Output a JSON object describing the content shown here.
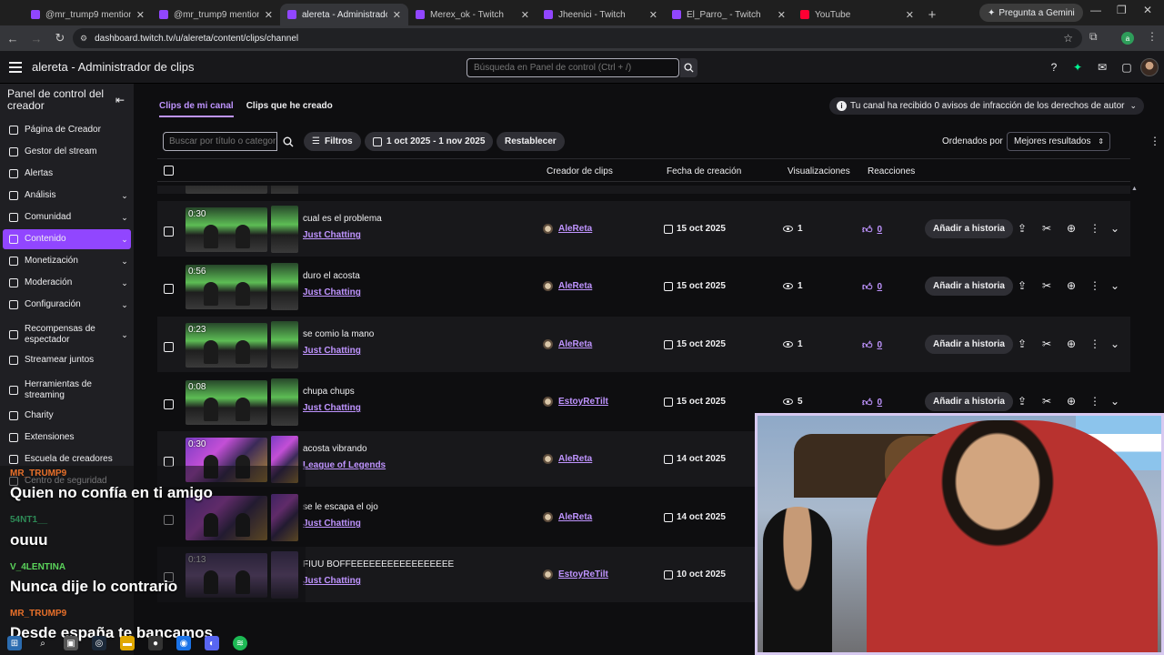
{
  "browser": {
    "tabs": [
      {
        "title": "@mr_trump9 mentioned y",
        "active": false
      },
      {
        "title": "@mr_trump9 mentioned y",
        "active": false
      },
      {
        "title": "alereta - Administrador de",
        "active": true
      },
      {
        "title": "Merex_ok - Twitch",
        "active": false
      },
      {
        "title": "Jheenici - Twitch",
        "active": false
      },
      {
        "title": "El_Parro_ - Twitch",
        "active": false
      },
      {
        "title": "YouTube",
        "active": false
      }
    ],
    "gemini_label": "Pregunta a Gemini",
    "url": "dashboard.twitch.tv/u/alereta/content/clips/channel",
    "profile_initial": "a"
  },
  "topnav": {
    "title": "alereta - Administrador de clips",
    "search_placeholder": "Búsqueda en Panel de control (Ctrl + /)"
  },
  "sidebar": {
    "heading": "Panel de control del creador",
    "items": [
      {
        "label": "Página de Creador",
        "chevron": false,
        "active": false
      },
      {
        "label": "Gestor del stream",
        "chevron": false,
        "active": false
      },
      {
        "label": "Alertas",
        "chevron": false,
        "active": false
      },
      {
        "label": "Análisis",
        "chevron": true,
        "active": false
      },
      {
        "label": "Comunidad",
        "chevron": true,
        "active": false
      },
      {
        "label": "Contenido",
        "chevron": true,
        "active": true
      },
      {
        "label": "Monetización",
        "chevron": true,
        "active": false
      },
      {
        "label": "Moderación",
        "chevron": true,
        "active": false
      },
      {
        "label": "Configuración",
        "chevron": true,
        "active": false
      },
      {
        "label": "Recompensas de espectador",
        "chevron": true,
        "active": false
      },
      {
        "label": "Streamear juntos",
        "chevron": false,
        "active": false
      },
      {
        "label": "Herramientas de streaming",
        "chevron": false,
        "active": false
      },
      {
        "label": "Charity",
        "chevron": false,
        "active": false
      },
      {
        "label": "Extensiones",
        "chevron": false,
        "active": false
      },
      {
        "label": "Escuela de creadores",
        "chevron": false,
        "active": false
      },
      {
        "label": "Centro de seguridad",
        "chevron": false,
        "active": false
      }
    ]
  },
  "content": {
    "tabs": [
      {
        "label": "Clips de mi canal",
        "active": true
      },
      {
        "label": "Clips que he creado",
        "active": false
      }
    ],
    "notice": "Tu canal ha recibido 0 avisos de infracción de los derechos de autor",
    "filters": {
      "search_placeholder": "Buscar por título o categoría",
      "filters_label": "Filtros",
      "date_range": "1 oct 2025 - 1 nov 2025",
      "reset_label": "Restablecer",
      "sort_label": "Ordenados por",
      "sort_value": "Mejores resultados"
    },
    "columns": {
      "creator": "Creador de clips",
      "date": "Fecha de creación",
      "views": "Visualizaciones",
      "reactions": "Reacciones"
    },
    "story_label": "Añadir a historia",
    "clips": [
      {
        "duration": "0:30",
        "title": "cual es el problema",
        "category": "Just Chatting",
        "creator": "AleReta",
        "date": "15 oct 2025",
        "views": "1",
        "reactions": "0",
        "theme": "green"
      },
      {
        "duration": "0:56",
        "title": "duro el acosta",
        "category": "Just Chatting",
        "creator": "AleReta",
        "date": "15 oct 2025",
        "views": "1",
        "reactions": "0",
        "theme": "green"
      },
      {
        "duration": "0:23",
        "title": "se comio la mano",
        "category": "Just Chatting",
        "creator": "AleReta",
        "date": "15 oct 2025",
        "views": "1",
        "reactions": "0",
        "theme": "green"
      },
      {
        "duration": "0:08",
        "title": "chupa chups",
        "category": "Just Chatting",
        "creator": "EstoyReTilt",
        "date": "15 oct 2025",
        "views": "5",
        "reactions": "0",
        "theme": "green"
      },
      {
        "duration": "0:30",
        "title": "acosta vibrando",
        "category": "League of Legends",
        "creator": "AleReta",
        "date": "14 oct 2025",
        "views": "",
        "reactions": "",
        "theme": "purple"
      },
      {
        "duration": "",
        "title": "se le escapa el ojo",
        "category": "Just Chatting",
        "creator": "AleReta",
        "date": "14 oct 2025",
        "views": "",
        "reactions": "",
        "theme": "purple"
      },
      {
        "duration": "0:13",
        "title": "FIUU BOFFEEEEEEEEEEEEEEEEE",
        "category": "Just Chatting",
        "creator": "EstoyReTilt",
        "date": "10 oct 2025",
        "views": "",
        "reactions": "",
        "theme": "violet"
      }
    ]
  },
  "chat": [
    {
      "user": "MR_TRUMP9",
      "user_color": "#e8702a",
      "message": "Quien no confía en ti amigo"
    },
    {
      "user": "54NT1__",
      "user_color": "#2e8b57",
      "message": "ouuu"
    },
    {
      "user": "V_4LENTINA",
      "user_color": "#5bd45b",
      "message": "Nunca dije lo contrario"
    },
    {
      "user": "MR_TRUMP9",
      "user_color": "#e8702a",
      "message": "Desde españa te bancamos"
    }
  ],
  "colors": {
    "accent": "#9146ff",
    "link": "#bf94ff",
    "background": "#0e0e10"
  }
}
